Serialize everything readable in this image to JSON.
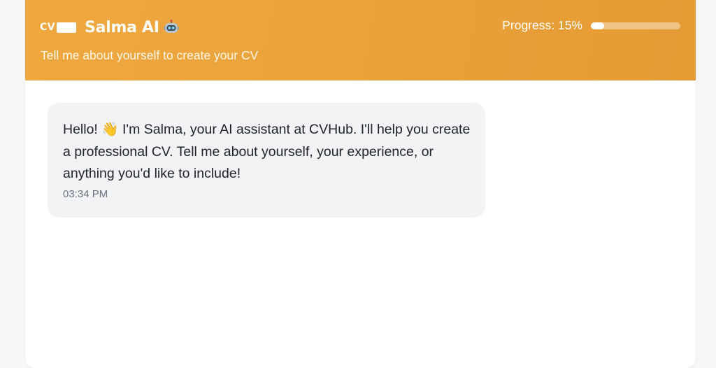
{
  "header": {
    "logo_text": "CV",
    "title": "Salma AI",
    "title_icon": "robot-icon",
    "subtitle": "Tell me about yourself to create your CV",
    "progress_label": "Progress: 15%",
    "progress_value": 0.15
  },
  "chat": {
    "messages": [
      {
        "text": "Hello! 👋 I'm Salma, your AI assistant at CVHub. I'll help you create a professional CV. Tell me about yourself, your experience, or anything you'd like to include!",
        "time": "03:34 PM"
      }
    ]
  },
  "colors": {
    "header_start": "#efa83f",
    "header_end": "#e69b35",
    "bubble_bg": "#f2f3f5"
  }
}
